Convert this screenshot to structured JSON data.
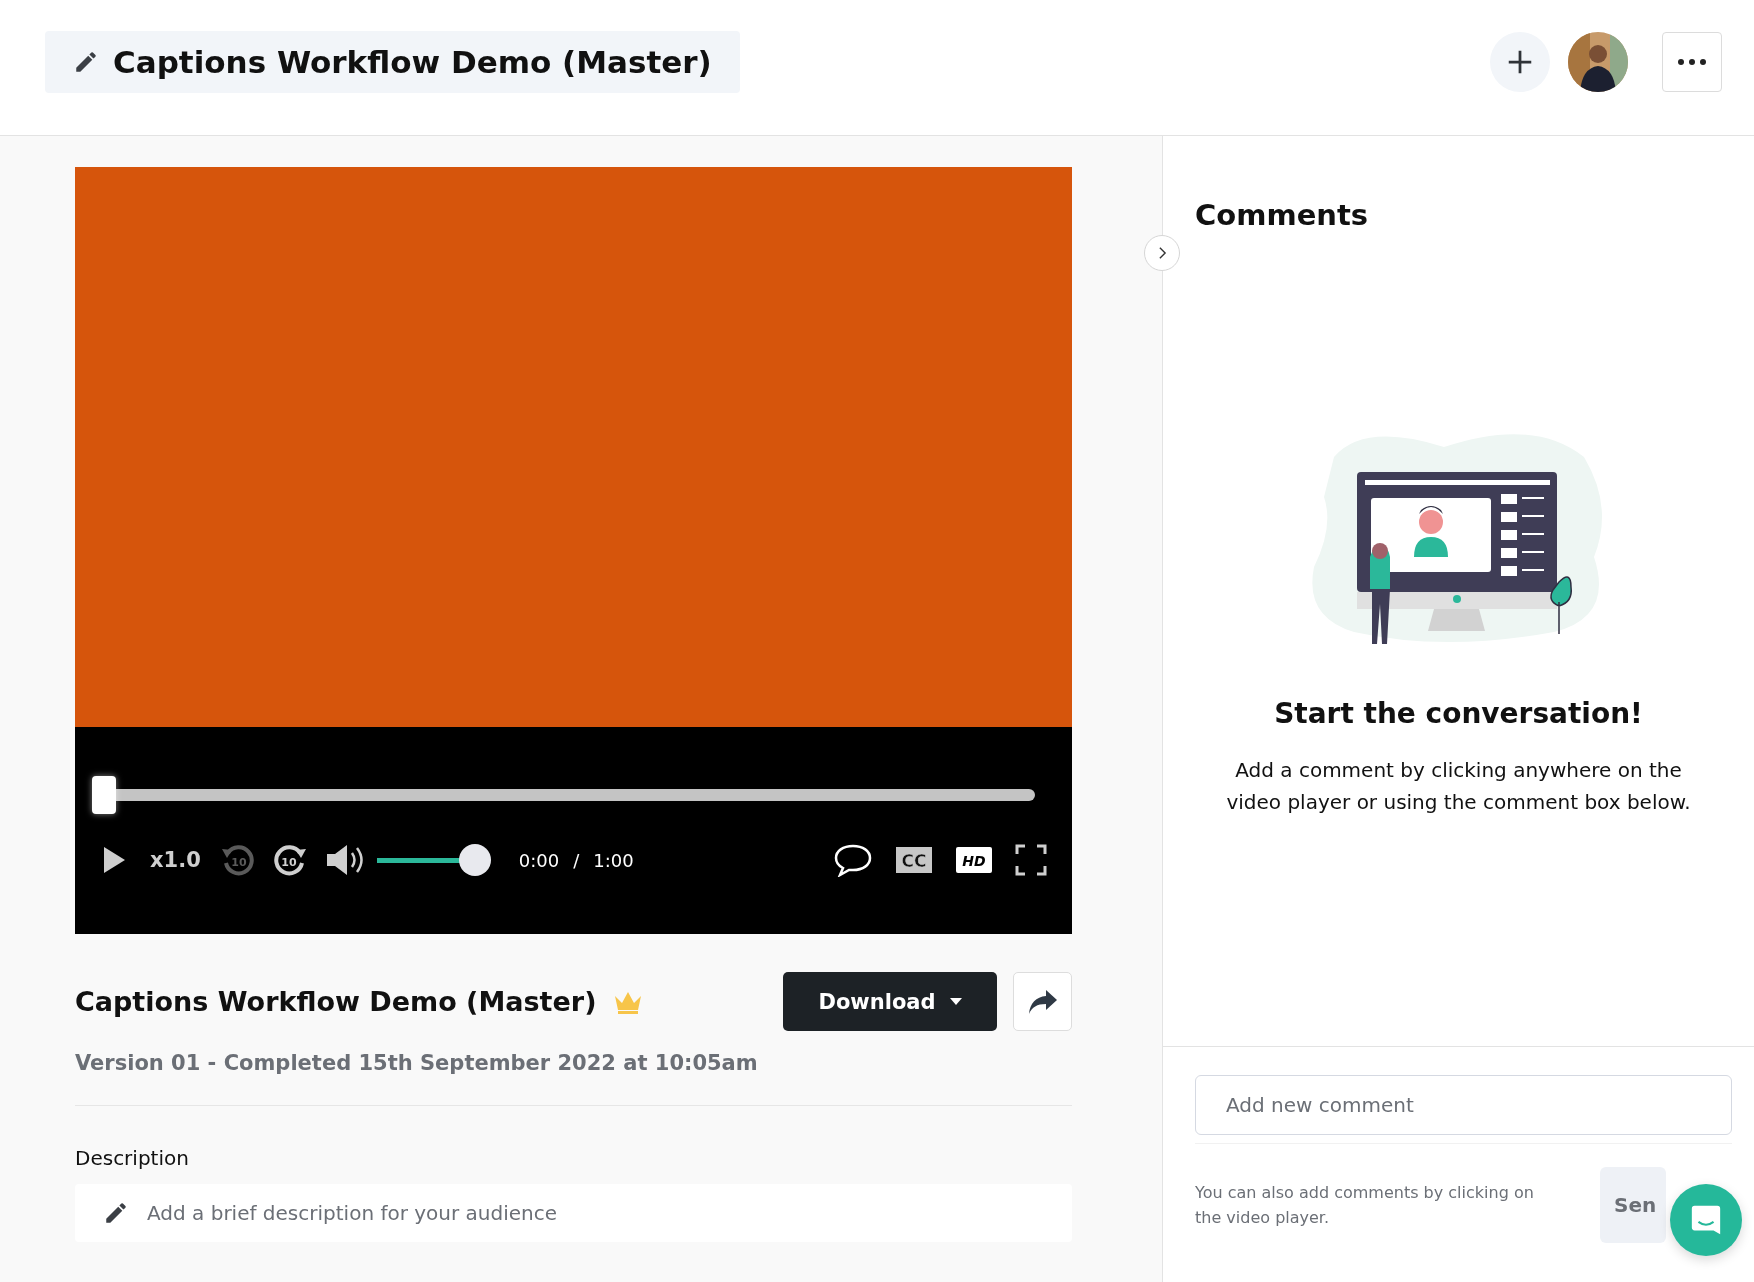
{
  "header": {
    "title": "Captions Workflow Demo (Master)"
  },
  "player": {
    "progress": {
      "level": 0
    },
    "speed": "x1.0",
    "rewind_label": "10",
    "forward_label": "10",
    "volume": {
      "level": 1
    },
    "current_time": "0:00",
    "separator": "/",
    "duration": "1:00",
    "cc_label": "CC",
    "hd_label": "HD"
  },
  "video": {
    "title": "Captions Workflow Demo (Master)",
    "version": "Version 01 - Completed 15th September 2022 at 10:05am",
    "download": "Download"
  },
  "description": {
    "label": "Description",
    "placeholder": "Add a brief description for your audience"
  },
  "comments": {
    "title": "Comments",
    "empty_title": "Start the conversation!",
    "empty_text": "Add a comment by clicking anywhere on the video player or using the comment box below.",
    "input_placeholder": "Add new comment",
    "hint": "You can also add comments by clicking on the video player.",
    "send": "Sen"
  }
}
